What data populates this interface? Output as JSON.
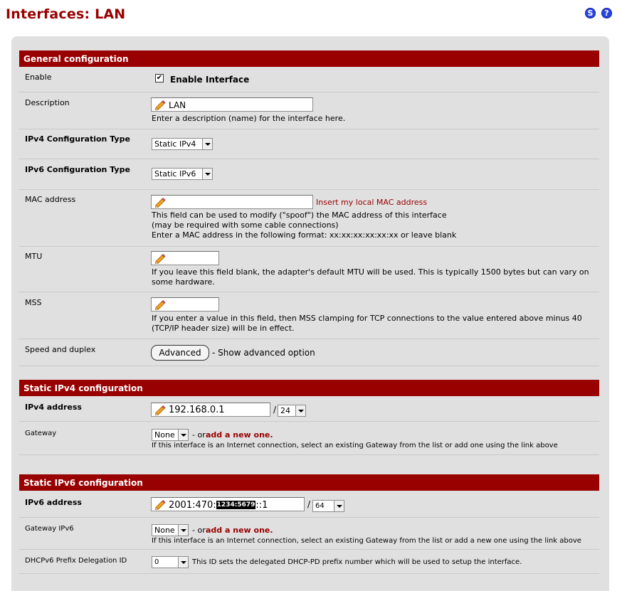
{
  "page": {
    "title": "Interfaces: LAN"
  },
  "top_icons": {
    "status": "S",
    "help": "?"
  },
  "general": {
    "header": "General configuration",
    "enable": {
      "label": "Enable",
      "checkbox_label": "Enable Interface",
      "checked": true
    },
    "description": {
      "label": "Description",
      "value": "LAN",
      "help": "Enter a description (name) for the interface here."
    },
    "ipv4_type": {
      "label": "IPv4 Configuration Type",
      "value": "Static IPv4"
    },
    "ipv6_type": {
      "label": "IPv6 Configuration Type",
      "value": "Static IPv6"
    },
    "mac": {
      "label": "MAC address",
      "value": "",
      "link": "Insert my local MAC address",
      "help1": "This field can be used to modify (\"spoof\") the MAC address of this interface",
      "help2": "(may be required with some cable connections)",
      "help3": "Enter a MAC address in the following format: xx:xx:xx:xx:xx:xx or leave blank"
    },
    "mtu": {
      "label": "MTU",
      "value": "",
      "help": "If you leave this field blank, the adapter's default MTU will be used. This is typically 1500 bytes but can vary on some hardware."
    },
    "mss": {
      "label": "MSS",
      "value": "",
      "help": "If you enter a value in this field, then MSS clamping for TCP connections to the value entered above minus 40 (TCP/IP header size) will be in effect."
    },
    "speed": {
      "label": "Speed and duplex",
      "button": "Advanced",
      "after": "- Show advanced option"
    }
  },
  "ipv4": {
    "header": "Static IPv4 configuration",
    "address": {
      "label": "IPv4 address",
      "value": "192.168.0.1",
      "slash": "/",
      "prefix": "24"
    },
    "gateway": {
      "label": "Gateway",
      "value": "None",
      "or": "- or",
      "add_link": "add a new one.",
      "help": "If this interface is an Internet connection, select an existing Gateway from the list or add one using the link above"
    }
  },
  "ipv6": {
    "header": "Static IPv6 configuration",
    "address": {
      "label": "IPv6 address",
      "value_start": "2001:470:",
      "value_redacted": "1234:5679",
      "value_end": "::1",
      "slash": "/",
      "prefix": "64"
    },
    "gateway": {
      "label": "Gateway IPv6",
      "value": "None",
      "or": "- or",
      "add_link": "add a new one.",
      "help": "If this interface is an Internet connection, select an existing Gateway from the list or add a new one using the link above"
    },
    "dhcp_pd": {
      "label": "DHCPv6 Prefix Delegation ID",
      "value": "0",
      "help": "This ID sets the delegated DHCP-PD prefix number which will be used to setup the interface."
    }
  }
}
